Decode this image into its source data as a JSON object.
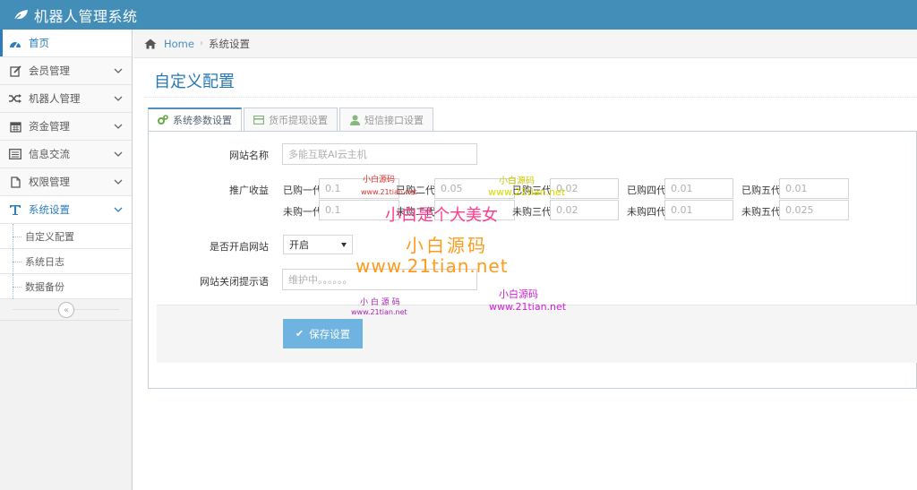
{
  "header": {
    "brand": "机器人管理系统",
    "logo_icon": "leaf-icon"
  },
  "sidebar": {
    "items": [
      {
        "label": "首页",
        "icon": "dashboard-icon"
      },
      {
        "label": "会员管理",
        "icon": "pencil-square-icon"
      },
      {
        "label": "机器人管理",
        "icon": "random-icon"
      },
      {
        "label": "资金管理",
        "icon": "calendar-icon"
      },
      {
        "label": "信息交流",
        "icon": "list-alt-icon"
      },
      {
        "label": "权限管理",
        "icon": "file-icon"
      },
      {
        "label": "系统设置",
        "icon": "text-icon"
      }
    ],
    "sub_items": [
      "自定义配置",
      "系统日志",
      "数据备份"
    ],
    "collapse_glyph": "«"
  },
  "breadcrumbs": {
    "home": "Home",
    "current": "系统设置"
  },
  "page": {
    "title": "自定义配置"
  },
  "tabs": [
    {
      "label": "系统参数设置",
      "icon": "cogs-icon"
    },
    {
      "label": "货币提现设置",
      "icon": "credit-card-icon"
    },
    {
      "label": "短信接口设置",
      "icon": "user-icon"
    }
  ],
  "form": {
    "site_name_label": "网站名称",
    "site_name_placeholder": "多能互联AI云主机",
    "promo_label": "推广收益",
    "bought": [
      {
        "label": "已购一代",
        "value": "0.1"
      },
      {
        "label": "已购二代",
        "value": "0.05"
      },
      {
        "label": "已购三代",
        "value": "0.02"
      },
      {
        "label": "已购四代",
        "value": "0.01"
      },
      {
        "label": "已购五代",
        "value": "0.01"
      }
    ],
    "unbought": [
      {
        "label": "未购一代",
        "value": "0.1"
      },
      {
        "label": "未购二代",
        "value": ""
      },
      {
        "label": "未购三代",
        "value": "0.02"
      },
      {
        "label": "未购四代",
        "value": "0.01"
      },
      {
        "label": "未购五代",
        "value": "0.025"
      }
    ],
    "site_open_label": "是否开启网站",
    "site_open_value": "开启",
    "close_tip_label": "网站关闭提示语",
    "close_tip_value": "维护中。。。。。。",
    "save_label": "保存设置"
  },
  "watermarks": {
    "small_brand": "小白源码",
    "small_brand_spaced": "小 白 源 码",
    "small_url": "www.21tian.net",
    "big_slogan": "小白是个大美女",
    "big_brand": "小白源码",
    "big_url": "www.21tian.net"
  }
}
